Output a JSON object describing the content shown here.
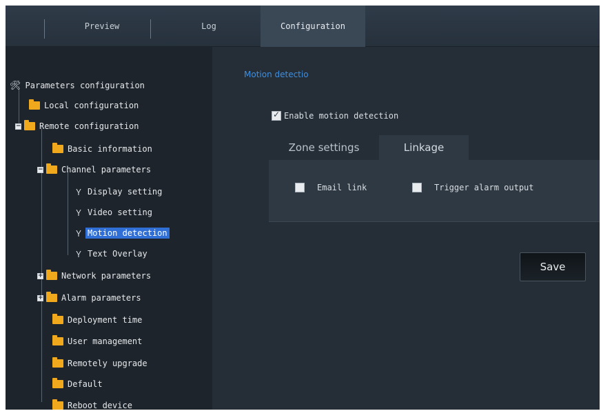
{
  "top_tabs": [
    {
      "label": "Preview"
    },
    {
      "label": "Log"
    },
    {
      "label": "Configuration",
      "active": true
    }
  ],
  "sidebar": {
    "root_label": "Parameters configuration",
    "items": [
      {
        "label": "Local configuration"
      },
      {
        "label": "Remote configuration",
        "expander": "−"
      },
      {
        "label": "Basic information"
      },
      {
        "label": "Channel parameters",
        "expander": "−"
      },
      {
        "label": "Display setting"
      },
      {
        "label": "Video setting"
      },
      {
        "label": "Motion detection",
        "selected": true
      },
      {
        "label": "Text Overlay"
      },
      {
        "label": "Network parameters",
        "expander": "+"
      },
      {
        "label": "Alarm parameters",
        "expander": "+"
      },
      {
        "label": "Deployment time"
      },
      {
        "label": "User management"
      },
      {
        "label": "Remotely upgrade"
      },
      {
        "label": "Default"
      },
      {
        "label": "Reboot device"
      }
    ]
  },
  "main": {
    "section_title": "Motion detectio",
    "enable_label": "Enable motion detection",
    "enable_checked": true,
    "sub_tabs": [
      {
        "label": "Zone settings"
      },
      {
        "label": "Linkage",
        "active": true
      }
    ],
    "linkage_options": [
      {
        "label": "Email link",
        "checked": false
      },
      {
        "label": "Trigger alarm output",
        "checked": false
      }
    ],
    "save_label": "Save"
  },
  "colors": {
    "accent": "#3f8fe0",
    "selection": "#2f6fd6",
    "folder": "#f0a81c",
    "background": "#232b33"
  }
}
